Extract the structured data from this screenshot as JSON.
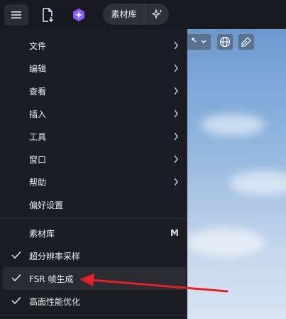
{
  "toolbar": {
    "items": [
      {
        "name": "hamburger-menu",
        "icon": "menu-icon"
      },
      {
        "name": "import-file",
        "icon": "file-import-icon"
      },
      {
        "name": "ai-assistant",
        "icon": "ai-sparkle-logo"
      }
    ],
    "asset_library_label": "素材库",
    "ai_tool_icon": "sparkle-icon"
  },
  "canvas": {
    "tool_icons": [
      "transform-icon",
      "globe-icon",
      "eyedropper-icon"
    ]
  },
  "menu": {
    "items": [
      {
        "label": "文件",
        "submenu": true
      },
      {
        "label": "编辑",
        "submenu": true
      },
      {
        "label": "查看",
        "submenu": true
      },
      {
        "label": "插入",
        "submenu": true
      },
      {
        "label": "工具",
        "submenu": true
      },
      {
        "label": "窗口",
        "submenu": true
      },
      {
        "label": "帮助",
        "submenu": true
      },
      {
        "label": "偏好设置",
        "submenu": false
      }
    ],
    "toggles": [
      {
        "label": "素材库",
        "shortcut": "M",
        "checked": false
      },
      {
        "label": "超分辨率采样",
        "checked": true
      },
      {
        "label": "FSR 帧生成",
        "checked": true,
        "highlighted": true
      },
      {
        "label": "高面性能优化",
        "checked": true
      }
    ]
  },
  "colors": {
    "accent_purple": "#8b5cf6",
    "annotation_arrow": "#e5202a",
    "menu_bg": "#1b1d22"
  }
}
